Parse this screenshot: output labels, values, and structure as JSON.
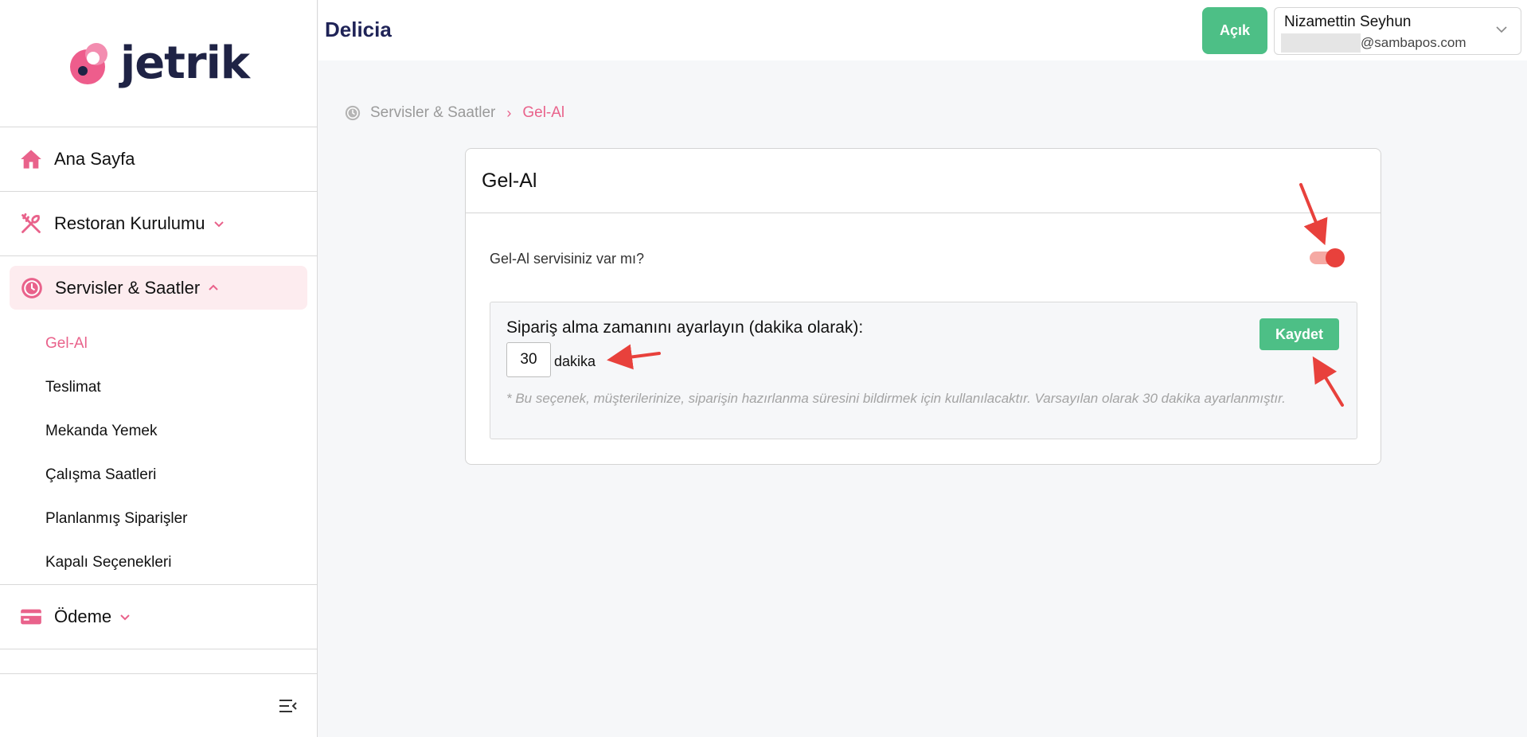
{
  "brand": {
    "name": "jetrik"
  },
  "sidebar": {
    "items": [
      {
        "label": "Ana Sayfa",
        "icon": "home-icon"
      },
      {
        "label": "Restoran Kurulumu",
        "icon": "utensils-icon"
      },
      {
        "label": "Servisler & Saatler",
        "icon": "clock-icon"
      },
      {
        "label": "Ödeme",
        "icon": "credit-card-icon"
      }
    ],
    "subitems": [
      {
        "label": "Gel-Al"
      },
      {
        "label": "Teslimat"
      },
      {
        "label": "Mekanda Yemek"
      },
      {
        "label": "Çalışma Saatleri"
      },
      {
        "label": "Planlanmış Siparişler"
      },
      {
        "label": "Kapalı Seçenekleri"
      }
    ]
  },
  "header": {
    "shop_name": "Delicia",
    "status_label": "Açık",
    "user_name": "Nizamettin Seyhun",
    "user_email_domain": "@sambapos.com"
  },
  "breadcrumb": {
    "parent": "Servisler & Saatler",
    "separator": "›",
    "current": "Gel-Al"
  },
  "card": {
    "title": "Gel-Al",
    "question": "Gel-Al servisiniz var mı?",
    "toggle_on": true,
    "setting_label": "Sipariş alma zamanını ayarlayın (dakika olarak):",
    "minutes_value": "30",
    "unit_label": "dakika",
    "save_label": "Kaydet",
    "note": "*  Bu seçenek, müşterilerinize, siparişin hazırlanma süresini bildirmek için kullanılacaktır. Varsayılan olarak 30 dakika ayarlanmıştır."
  },
  "colors": {
    "accent_pink": "#e9628b",
    "green": "#4dbf86",
    "navy": "#1f2357",
    "annotation_red": "#e8413c"
  }
}
